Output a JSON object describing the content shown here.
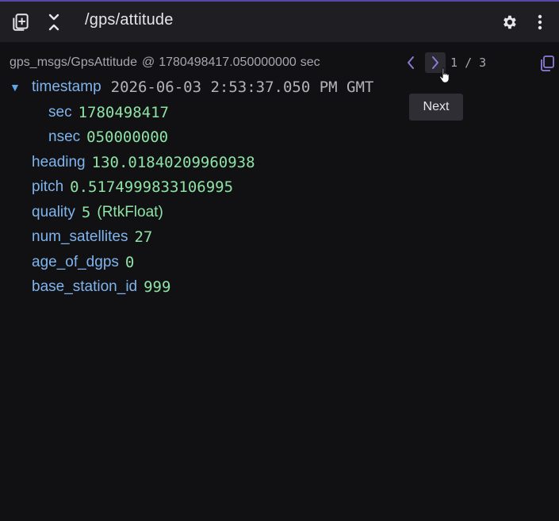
{
  "header": {
    "topic": "/gps/attitude",
    "icons": {
      "topic_picker": "copy-plus-icon",
      "collapse": "collapse-icon",
      "settings": "gear-icon",
      "menu": "more-vertical-icon"
    }
  },
  "message": {
    "schema": "gps_msgs/GpsAttitude",
    "at_label": "@",
    "receive_time": "1780498417.050000000",
    "unit": "sec",
    "page_current": "1",
    "page_sep": "/",
    "page_total": "3",
    "prev_icon": "chevron-left-icon",
    "next_icon": "chevron-right-icon",
    "copy_icon": "copy-icon"
  },
  "tooltip": {
    "next": "Next"
  },
  "fields": {
    "timestamp": {
      "label": "timestamp",
      "value": "2026-06-03 2:53:37.050 PM GMT",
      "toggle": "▼",
      "sec": {
        "label": "sec",
        "value": "1780498417"
      },
      "nsec": {
        "label": "nsec",
        "value": "050000000"
      }
    },
    "heading": {
      "label": "heading",
      "value": "130.01840209960938"
    },
    "pitch": {
      "label": "pitch",
      "value": "0.5174999833106995"
    },
    "quality": {
      "label": "quality",
      "value": "5",
      "enum": "(RtkFloat)"
    },
    "num_satellites": {
      "label": "num_satellites",
      "value": "27"
    },
    "age_of_dgps": {
      "label": "age_of_dgps",
      "value": "0"
    },
    "base_station_id": {
      "label": "base_station_id",
      "value": "999"
    }
  },
  "colors": {
    "key": "#7fb4ee",
    "value": "#8ee2a5",
    "accent": "#8a7dd8",
    "background": "#111113",
    "toolbar": "#1f1f23"
  }
}
